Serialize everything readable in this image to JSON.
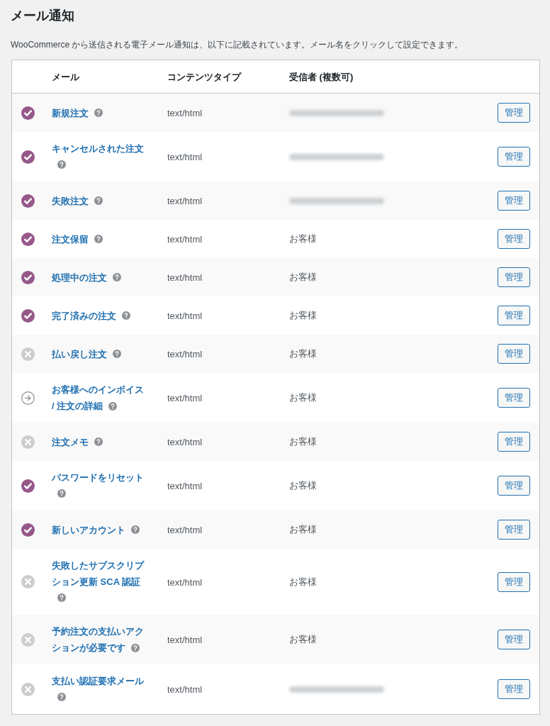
{
  "page": {
    "title": "メール通知",
    "description": "WooCommerce から送信される電子メール通知は、以下に記載されています。メール名をクリックして設定できます。"
  },
  "table": {
    "columns": [
      "メール",
      "コンテンツタイプ",
      "受信者 (複数可)"
    ],
    "rows": [
      {
        "kind": "enabled",
        "name": "新規注文",
        "content_type": "text/html",
        "recipient": {
          "kind": "blurred"
        },
        "action": "管理"
      },
      {
        "kind": "enabled",
        "name": "キャンセルされた注文",
        "content_type": "text/html",
        "recipient": {
          "kind": "blurred"
        },
        "action": "管理"
      },
      {
        "kind": "enabled",
        "name": "失敗注文",
        "content_type": "text/html",
        "recipient": {
          "kind": "blurred"
        },
        "action": "管理"
      },
      {
        "kind": "enabled",
        "name": "注文保留",
        "content_type": "text/html",
        "recipient": {
          "kind": "text",
          "text": "お客様"
        },
        "action": "管理"
      },
      {
        "kind": "enabled",
        "name": "処理中の注文",
        "content_type": "text/html",
        "recipient": {
          "kind": "text",
          "text": "お客様"
        },
        "action": "管理"
      },
      {
        "kind": "enabled",
        "name": "完了済みの注文",
        "content_type": "text/html",
        "recipient": {
          "kind": "text",
          "text": "お客様"
        },
        "action": "管理"
      },
      {
        "kind": "disabled",
        "name": "払い戻し注文",
        "content_type": "text/html",
        "recipient": {
          "kind": "text",
          "text": "お客様"
        },
        "action": "管理"
      },
      {
        "kind": "manual",
        "name": "お客様へのインボイス / 注文の詳細",
        "content_type": "text/html",
        "recipient": {
          "kind": "text",
          "text": "お客様"
        },
        "action": "管理"
      },
      {
        "kind": "disabled",
        "name": "注文メモ",
        "content_type": "text/html",
        "recipient": {
          "kind": "text",
          "text": "お客様"
        },
        "action": "管理"
      },
      {
        "kind": "enabled",
        "name": "パスワードをリセット",
        "content_type": "text/html",
        "recipient": {
          "kind": "text",
          "text": "お客様"
        },
        "action": "管理"
      },
      {
        "kind": "enabled",
        "name": "新しいアカウント",
        "content_type": "text/html",
        "recipient": {
          "kind": "text",
          "text": "お客様"
        },
        "action": "管理"
      },
      {
        "kind": "disabled",
        "name": "失敗したサブスクリプション更新 SCA 認証",
        "content_type": "text/html",
        "recipient": {
          "kind": "text",
          "text": "お客様"
        },
        "action": "管理"
      },
      {
        "kind": "disabled",
        "name": "予約注文の支払いアクションが必要です",
        "content_type": "text/html",
        "recipient": {
          "kind": "text",
          "text": "お客様"
        },
        "action": "管理"
      },
      {
        "kind": "disabled",
        "name": "支払い認証要求メール",
        "content_type": "text/html",
        "recipient": {
          "kind": "blurred"
        },
        "action": "管理"
      }
    ]
  }
}
